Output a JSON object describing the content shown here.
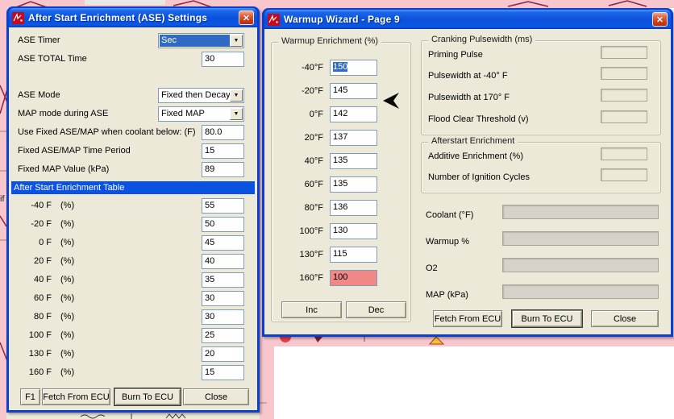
{
  "icons": {
    "close": "✕",
    "dropdown": "▼"
  },
  "background": {
    "fragment_text": "if"
  },
  "colors": {
    "titlebar_blue": "#0A50DC",
    "window_border": "#0A3FD1",
    "selection_blue": "#316AC5",
    "alert_cell_pink": "#F28787",
    "backdrop_pink": "#F8C7CD",
    "dialog_face": "#ECE9D8"
  },
  "ase_dialog": {
    "title": "After Start Enrichment (ASE) Settings",
    "fields": {
      "ase_timer": {
        "label": "ASE Timer",
        "value": "Sec"
      },
      "ase_total_time": {
        "label": "ASE TOTAL Time",
        "value": "30"
      },
      "ase_mode": {
        "label": "ASE Mode",
        "value": "Fixed then Decay"
      },
      "map_mode": {
        "label": "MAP mode during ASE",
        "value": "Fixed MAP"
      },
      "coolant_below": {
        "label": "Use Fixed ASE/MAP when coolant below: (F)",
        "value": "80.0"
      },
      "fixed_time": {
        "label": "Fixed ASE/MAP Time Period",
        "value": "15"
      },
      "fixed_map": {
        "label": "Fixed MAP Value (kPa)",
        "value": "89"
      }
    },
    "table": {
      "header": "After Start Enrichment Table",
      "rows": [
        {
          "temp": "-40 F",
          "unit": "(%)",
          "value": "55"
        },
        {
          "temp": "-20 F",
          "unit": "(%)",
          "value": "50"
        },
        {
          "temp": "0  F",
          "unit": "(%)",
          "value": "45"
        },
        {
          "temp": "20 F",
          "unit": "(%)",
          "value": "40"
        },
        {
          "temp": "40 F",
          "unit": "(%)",
          "value": "35"
        },
        {
          "temp": "60 F",
          "unit": "(%)",
          "value": "30"
        },
        {
          "temp": "80 F",
          "unit": "(%)",
          "value": "30"
        },
        {
          "temp": "100 F",
          "unit": "(%)",
          "value": "25"
        },
        {
          "temp": "130 F",
          "unit": "(%)",
          "value": "20"
        },
        {
          "temp": "160 F",
          "unit": "(%)",
          "value": "15"
        }
      ]
    },
    "buttons": {
      "f1": "F1",
      "fetch": "Fetch From ECU",
      "burn": "Burn To ECU",
      "close": "Close"
    }
  },
  "warmup_dialog": {
    "title": "Warmup Wizard - Page 9",
    "warmup_group": {
      "title": "Warmup Enrichment (%)",
      "rows": [
        {
          "temp": "-40°F",
          "value": "150"
        },
        {
          "temp": "-20°F",
          "value": "145"
        },
        {
          "temp": "0°F",
          "value": "142"
        },
        {
          "temp": "20°F",
          "value": "137"
        },
        {
          "temp": "40°F",
          "value": "135"
        },
        {
          "temp": "60°F",
          "value": "135"
        },
        {
          "temp": "80°F",
          "value": "136"
        },
        {
          "temp": "100°F",
          "value": "130"
        },
        {
          "temp": "130°F",
          "value": "115"
        },
        {
          "temp": "160°F",
          "value": "100"
        }
      ],
      "inc_label": "Inc",
      "dec_label": "Dec"
    },
    "cranking_group": {
      "title": "Cranking Pulsewidth (ms)",
      "rows": [
        {
          "label": "Priming Pulse"
        },
        {
          "label": "Pulsewidth at -40° F"
        },
        {
          "label": "Pulsewidth at  170° F"
        },
        {
          "label": "Flood Clear Threshold (v)"
        }
      ]
    },
    "afterstart_group": {
      "title": "Afterstart Enrichment",
      "rows": [
        {
          "label": "Additive Enrichment (%)"
        },
        {
          "label": "Number of Ignition Cycles"
        }
      ]
    },
    "runtime_rows": [
      {
        "label": "Coolant (°F)"
      },
      {
        "label": "Warmup %"
      },
      {
        "label": "O2"
      },
      {
        "label": "MAP (kPa)"
      }
    ],
    "buttons": {
      "fetch": "Fetch From ECU",
      "burn": "Burn To ECU",
      "close": "Close"
    }
  }
}
